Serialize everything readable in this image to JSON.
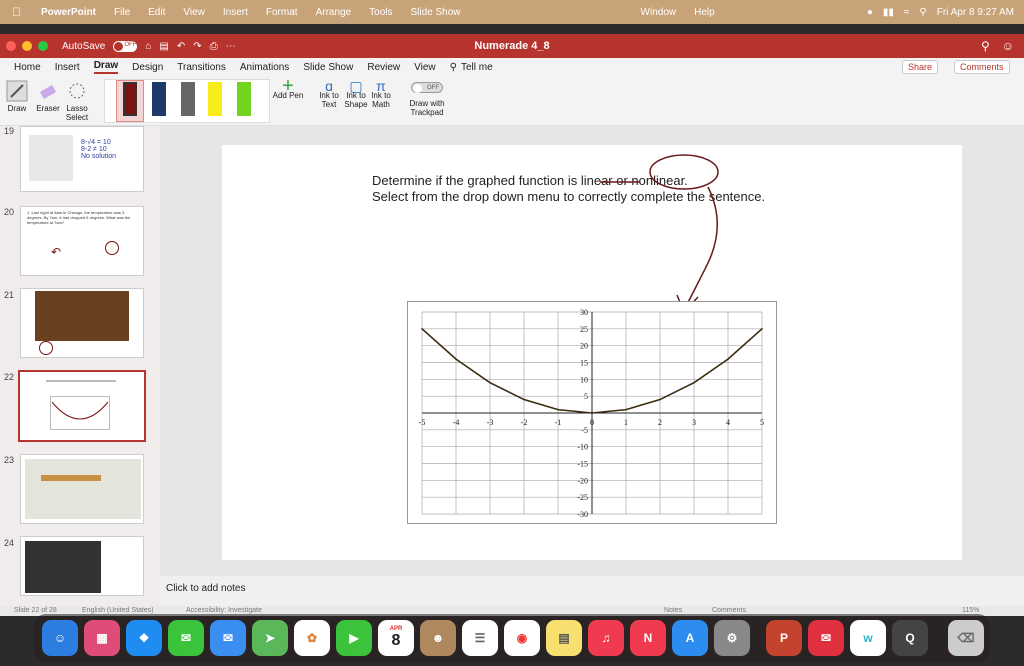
{
  "menubar": {
    "app": "PowerPoint",
    "items": [
      "File",
      "Edit",
      "View",
      "Insert",
      "Format",
      "Arrange",
      "Tools",
      "Slide Show"
    ],
    "right_items": [
      "Window",
      "Help"
    ],
    "datetime": "Fri Apr 8  9:27 AM"
  },
  "titlebar": {
    "autosave": "AutoSave",
    "autosave_state": "OFF",
    "doc_title": "Numerade 4_8"
  },
  "tabs": [
    "Home",
    "Insert",
    "Draw",
    "Design",
    "Transitions",
    "Animations",
    "Slide Show",
    "Review",
    "View"
  ],
  "active_tab": "Draw",
  "tell_me": "Tell me",
  "share": "Share",
  "comments": "Comments",
  "ribbon": {
    "draw": "Draw",
    "eraser": "Eraser",
    "lasso": "Lasso Select",
    "add_pen": "Add Pen",
    "ink_text": "Ink to Text",
    "ink_shape": "Ink to Shape",
    "ink_math": "Ink to Math",
    "trackpad": "Draw with Trackpad",
    "trackpad_state": "OFF"
  },
  "sidebar": {
    "slide_numbers": [
      "19",
      "20",
      "21",
      "22",
      "23",
      "24"
    ],
    "thumb20_text": "1. Last night at 8am in Chicago, the temperature was 3 degrees. By 7am, it had dropped 5 degrees. What was the temperature at 7am?"
  },
  "slide": {
    "line1": "Determine if the graphed function is linear or nonlinear.",
    "line2": "Select from the drop down menu to correctly complete the sentence."
  },
  "chart_data": {
    "type": "line",
    "x": [
      -5,
      -4,
      -3,
      -2,
      -1,
      0,
      1,
      2,
      3,
      4,
      5
    ],
    "y": [
      25,
      16,
      9,
      4,
      1,
      0,
      1,
      4,
      9,
      16,
      25
    ],
    "xlim": [
      -5,
      5
    ],
    "ylim": [
      -30,
      30
    ],
    "xticks": [
      "-5",
      "-4",
      "-3",
      "-2",
      "-1",
      "0",
      "1",
      "2",
      "3",
      "4",
      "5"
    ],
    "yticks_pos": [
      "30",
      "25",
      "20",
      "15",
      "10",
      "5"
    ],
    "yticks_neg": [
      "-5",
      "-10",
      "-15",
      "-20",
      "-25",
      "-30"
    ],
    "grid": true
  },
  "notes": "Click to add notes",
  "status": {
    "slide": "Slide 22 of 28",
    "language": "English (United States)",
    "accessibility": "Accessibility: Investigate",
    "notes": "Notes",
    "comments": "Comments",
    "zoom": "115%"
  },
  "dock": {
    "calendar_month": "APR",
    "calendar_day": "8"
  }
}
